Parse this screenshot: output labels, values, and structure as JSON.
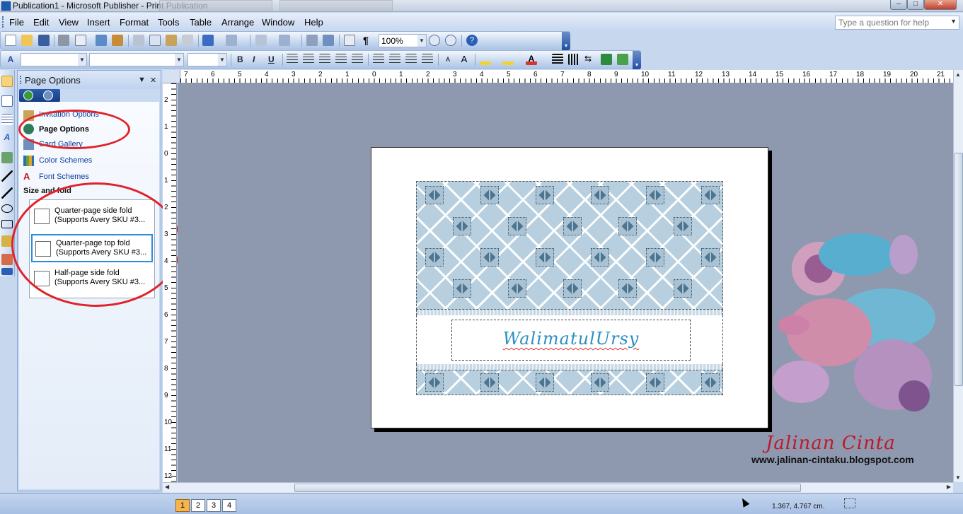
{
  "window": {
    "title": "Publication1 - Microsoft Publisher - Print Publication"
  },
  "menubar": {
    "items": [
      "File",
      "Edit",
      "View",
      "Insert",
      "Format",
      "Tools",
      "Table",
      "Arrange",
      "Window",
      "Help"
    ],
    "help_placeholder": "Type a question for help"
  },
  "toolbar": {
    "zoom": "100%",
    "font_style_value": "",
    "font_name_value": "",
    "font_size_value": "",
    "bold": "B",
    "italic": "I",
    "underline": "U",
    "icons": [
      "new-icon",
      "open-icon",
      "save-icon",
      "print-icon",
      "print-preview-icon",
      "spelling-icon",
      "research-icon",
      "cut-icon",
      "copy-icon",
      "paste-icon",
      "format-painter-icon",
      "undo-icon",
      "redo-icon",
      "bring-forward-icon",
      "rotate-icon",
      "insert-hyperlink-icon",
      "web-preview-icon",
      "columns-icon",
      "pilcrow-icon",
      "zoom-out-icon",
      "zoom-in-icon",
      "help-icon"
    ]
  },
  "taskpane": {
    "title": "Page Options",
    "links": [
      {
        "label": "Invitation Options",
        "icon": "invitation-options-icon"
      },
      {
        "label": "Page Options",
        "icon": "page-options-icon",
        "active": true
      },
      {
        "label": "Card Gallery",
        "icon": "card-gallery-icon"
      },
      {
        "label": "Color Schemes",
        "icon": "color-schemes-icon"
      },
      {
        "label": "Font Schemes",
        "icon": "font-schemes-icon"
      }
    ],
    "section": "Size and fold",
    "folds": [
      {
        "line1": "Quarter-page side fold",
        "line2": "(Supports Avery SKU #3..."
      },
      {
        "line1": "Quarter-page top fold",
        "line2": "(Supports Avery SKU #3...",
        "selected": true
      },
      {
        "line1": "Half-page side fold",
        "line2": "(Supports Avery SKU #3..."
      }
    ]
  },
  "ruler": {
    "top_numbers": [
      "7",
      "6",
      "5",
      "4",
      "3",
      "2",
      "1",
      "0",
      "1",
      "2",
      "3",
      "4",
      "5",
      "6",
      "7",
      "8",
      "9",
      "10",
      "11",
      "12",
      "13",
      "14",
      "15",
      "16",
      "17",
      "18",
      "19",
      "20",
      "21"
    ],
    "left_numbers": [
      "2",
      "1",
      "0",
      "1",
      "2",
      "3",
      "4",
      "5",
      "6",
      "7",
      "8",
      "9",
      "10",
      "11",
      "12"
    ]
  },
  "card": {
    "title": "WalimatulUrsy"
  },
  "watermark": {
    "name": "Jalinan Cinta",
    "url": "www.jalinan-cintaku.blogspot.com"
  },
  "status": {
    "pages": [
      "1",
      "2",
      "3",
      "4"
    ],
    "active_page": "1",
    "coords": "1.367, 4.767 cm."
  },
  "colors": {
    "annotation": "#e0222a",
    "card_pattern": "#b7cfdf",
    "title_text": "#2a8fc2",
    "workspace": "#8e98ae"
  }
}
